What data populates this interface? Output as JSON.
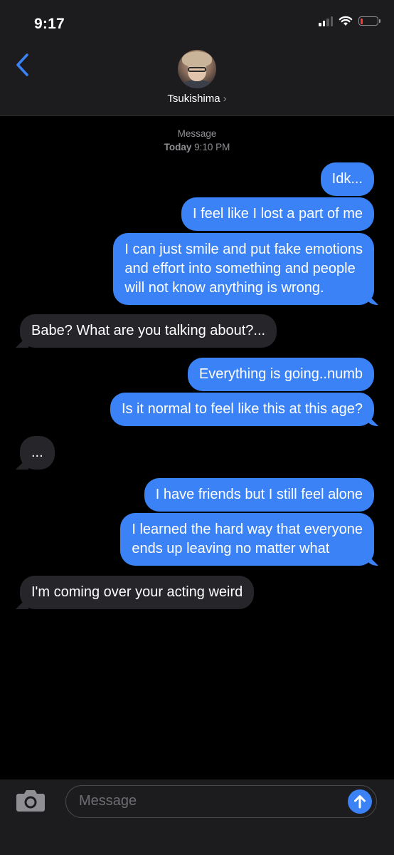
{
  "status_bar": {
    "time": "9:17"
  },
  "header": {
    "contact_name": "Tsukishima",
    "chevron": "›"
  },
  "timestamp": {
    "line1": "Message",
    "day": "Today",
    "time": "9:10 PM"
  },
  "messages": [
    {
      "from": "me",
      "text": "Idk..."
    },
    {
      "from": "me",
      "text": "I feel like I lost a part of me"
    },
    {
      "from": "me",
      "text": "I can just smile and put fake emotions\nand effort into something and people\nwill not know anything is wrong."
    },
    {
      "from": "them",
      "text": "Babe? What are you talking about?..."
    },
    {
      "from": "me",
      "text": "Everything is going..numb"
    },
    {
      "from": "me",
      "text": "Is it normal to feel like this at this age?"
    },
    {
      "from": "them",
      "text": "..."
    },
    {
      "from": "me",
      "text": "I have friends but I still feel alone"
    },
    {
      "from": "me",
      "text": "I learned the hard way that everyone\nends up leaving no matter what"
    },
    {
      "from": "them",
      "text": "I'm coming over your acting weird"
    }
  ],
  "composer": {
    "placeholder": "Message"
  },
  "colors": {
    "sent_bubble": "#3b82f6",
    "received_bubble": "#26252a",
    "header_bg": "#1c1c1e"
  },
  "icons": [
    "back-chevron-icon",
    "camera-icon",
    "send-arrow-icon",
    "signal-icon",
    "wifi-icon",
    "battery-icon"
  ]
}
